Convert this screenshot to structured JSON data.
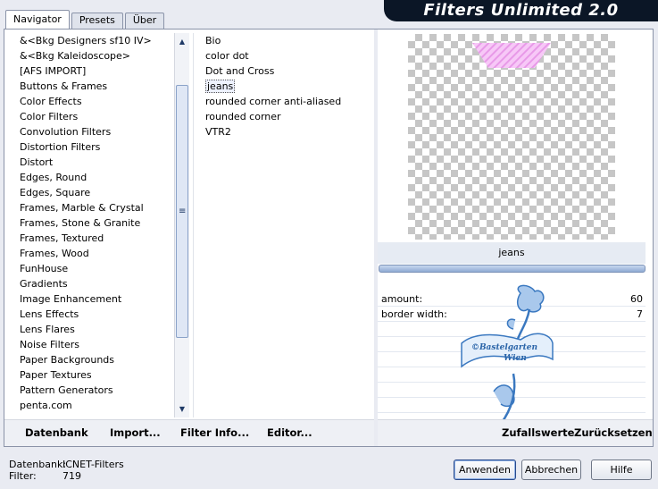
{
  "tabs": [
    {
      "label": "Navigator",
      "active": true
    },
    {
      "label": "Presets",
      "active": false
    },
    {
      "label": "Über",
      "active": false
    }
  ],
  "title": "Filters Unlimited 2.0",
  "categories": [
    "&<Bkg Designers sf10 IV>",
    "&<Bkg Kaleidoscope>",
    "[AFS IMPORT]",
    "Buttons & Frames",
    "Color Effects",
    "Color Filters",
    "Convolution Filters",
    "Distortion Filters",
    "Distort",
    "Edges, Round",
    "Edges, Square",
    "Frames, Marble & Crystal",
    "Frames, Stone & Granite",
    "Frames, Textured",
    "Frames, Wood",
    "FunHouse",
    "Gradients",
    "Image Enhancement",
    "Lens Effects",
    "Lens Flares",
    "Noise Filters",
    "Paper Backgrounds",
    "Paper Textures",
    "Pattern Generators",
    "penta.com"
  ],
  "filters": [
    "Bio",
    "color dot",
    "Dot and Cross",
    "jeans",
    "rounded corner anti-aliased",
    "rounded corner",
    "VTR2"
  ],
  "selected_filter_index": 3,
  "preview": {
    "filter_name": "jeans",
    "shape_color": "#f2b8f2"
  },
  "parameters": [
    {
      "label": "amount:",
      "value": "60"
    },
    {
      "label": "border width:",
      "value": "7"
    }
  ],
  "watermark": {
    "line1": "©Bastelgarten",
    "line2": "Wien"
  },
  "toolbar_left": [
    {
      "label": "Datenbank"
    },
    {
      "label": "Import..."
    },
    {
      "label": "Filter Info..."
    },
    {
      "label": "Editor..."
    }
  ],
  "toolbar_right": [
    {
      "label": "Zufallswerte"
    },
    {
      "label": "Zurücksetzen"
    }
  ],
  "status": {
    "database_label": "Datenbank:",
    "database_value": "ICNET-Filters",
    "filter_label": "Filter:",
    "filter_value": "719"
  },
  "buttons": {
    "apply": "Anwenden",
    "cancel": "Abbrechen",
    "help": "Hilfe"
  },
  "colors": {
    "title_bg": "#0b1626",
    "accent": "#8faad3",
    "window_bg": "#e9ebf2"
  }
}
